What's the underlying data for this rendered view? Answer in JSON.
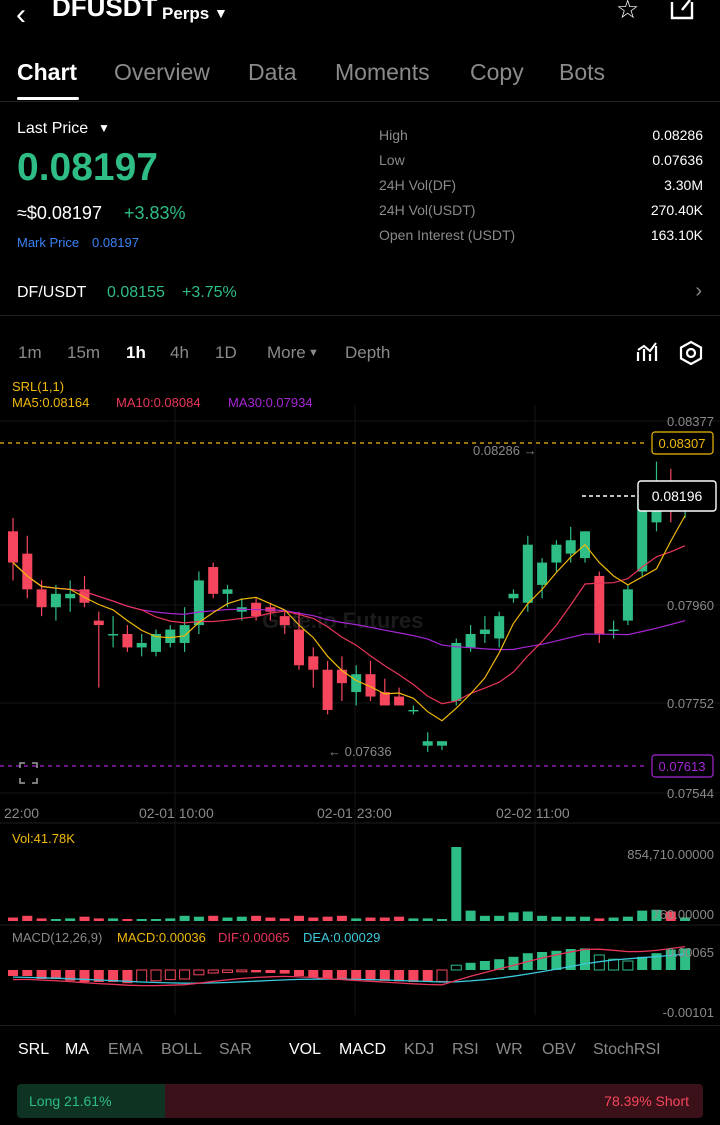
{
  "header": {
    "back_icon": "chevron-left-icon",
    "symbol": "DFUSDT",
    "market_type": "Perps",
    "favorite_icon": "star-icon",
    "share_icon": "share-icon"
  },
  "tabs": [
    {
      "label": "Chart",
      "active": true
    },
    {
      "label": "Overview",
      "active": false
    },
    {
      "label": "Data",
      "active": false
    },
    {
      "label": "Moments",
      "active": false
    },
    {
      "label": "Copy",
      "active": false
    },
    {
      "label": "Bots",
      "active": false
    }
  ],
  "price": {
    "label": "Last Price",
    "value": "0.08197",
    "approx": "≈$0.08197",
    "change": "+3.83%",
    "mark_label": "Mark Price",
    "mark_value": "0.08197"
  },
  "stats": [
    {
      "label": "High",
      "value": "0.08286"
    },
    {
      "label": "Low",
      "value": "0.07636"
    },
    {
      "label": "24H Vol(DF)",
      "value": "3.30M"
    },
    {
      "label": "24H Vol(USDT)",
      "value": "270.40K"
    },
    {
      "label": "Open Interest (USDT)",
      "value": "163.10K"
    }
  ],
  "spot_pair": {
    "name": "DF/USDT",
    "price": "0.08155",
    "change": "+3.75%"
  },
  "timeframes": [
    {
      "label": "1m",
      "active": false
    },
    {
      "label": "15m",
      "active": false
    },
    {
      "label": "1h",
      "active": true
    },
    {
      "label": "4h",
      "active": false
    },
    {
      "label": "1D",
      "active": false
    },
    {
      "label": "More",
      "active": false
    },
    {
      "label": "Depth",
      "active": false
    }
  ],
  "indicators": {
    "srl": "SRL(1,1)",
    "ma5": "MA5:0.08164",
    "ma10": "MA10:0.08084",
    "ma30": "MA30:0.07934",
    "vol": "Vol:41.78K",
    "macd_name": "MACD(12,26,9)",
    "macd": "MACD:0.00036",
    "dif": "DIF:0.00065",
    "dea": "DEA:0.00029"
  },
  "price_axis": {
    "ticks": [
      "0.08377",
      "0.07960",
      "0.07752",
      "0.07544"
    ],
    "srl_upper": "0.08307",
    "srl_lower": "0.07613",
    "current": "0.08196",
    "high_marker": "0.08286 →",
    "low_marker": "← 0.07636"
  },
  "time_axis": [
    "22:00",
    "02-01 10:00",
    "02-01 23:00",
    "02-02 11:00"
  ],
  "volume_axis": [
    "854,710.00000",
    "760.00000"
  ],
  "macd_axis": [
    "0.00065",
    "-0.00101"
  ],
  "watermark": "Gate.io Futures",
  "colors": {
    "up": "#2ebd85",
    "down": "#f6465d",
    "ma5": "#f0b90b",
    "ma10": "#e8365a",
    "ma30": "#a626d6",
    "srl": "#f0b90b",
    "accent_blue": "#3b82f6"
  },
  "chart_data": {
    "type": "candlestick",
    "interval": "1h",
    "candles": [
      {
        "o": 0.0813,
        "h": 0.0816,
        "l": 0.0802,
        "c": 0.0806
      },
      {
        "o": 0.0808,
        "h": 0.0812,
        "l": 0.0798,
        "c": 0.08
      },
      {
        "o": 0.08,
        "h": 0.0802,
        "l": 0.0794,
        "c": 0.0796
      },
      {
        "o": 0.0796,
        "h": 0.0801,
        "l": 0.0793,
        "c": 0.0799
      },
      {
        "o": 0.0798,
        "h": 0.0802,
        "l": 0.0795,
        "c": 0.0799
      },
      {
        "o": 0.08,
        "h": 0.0803,
        "l": 0.0796,
        "c": 0.0797
      },
      {
        "o": 0.0793,
        "h": 0.0795,
        "l": 0.0778,
        "c": 0.0792
      },
      {
        "o": 0.079,
        "h": 0.0794,
        "l": 0.0787,
        "c": 0.079
      },
      {
        "o": 0.079,
        "h": 0.0792,
        "l": 0.0786,
        "c": 0.0787
      },
      {
        "o": 0.0787,
        "h": 0.079,
        "l": 0.0785,
        "c": 0.0788
      },
      {
        "o": 0.0786,
        "h": 0.0791,
        "l": 0.0785,
        "c": 0.079
      },
      {
        "o": 0.0788,
        "h": 0.0792,
        "l": 0.0787,
        "c": 0.0791
      },
      {
        "o": 0.0788,
        "h": 0.0796,
        "l": 0.0786,
        "c": 0.0792
      },
      {
        "o": 0.0792,
        "h": 0.0804,
        "l": 0.079,
        "c": 0.0802
      },
      {
        "o": 0.0805,
        "h": 0.0806,
        "l": 0.0798,
        "c": 0.0799
      },
      {
        "o": 0.0799,
        "h": 0.0801,
        "l": 0.0796,
        "c": 0.08
      },
      {
        "o": 0.0795,
        "h": 0.0798,
        "l": 0.0793,
        "c": 0.0796
      },
      {
        "o": 0.0797,
        "h": 0.0798,
        "l": 0.0793,
        "c": 0.0794
      },
      {
        "o": 0.0796,
        "h": 0.0797,
        "l": 0.0793,
        "c": 0.0795
      },
      {
        "o": 0.0794,
        "h": 0.0795,
        "l": 0.079,
        "c": 0.0792
      },
      {
        "o": 0.0791,
        "h": 0.0795,
        "l": 0.0782,
        "c": 0.0783
      },
      {
        "o": 0.0785,
        "h": 0.0787,
        "l": 0.0778,
        "c": 0.0782
      },
      {
        "o": 0.0782,
        "h": 0.0784,
        "l": 0.0772,
        "c": 0.0773
      },
      {
        "o": 0.0782,
        "h": 0.0785,
        "l": 0.0775,
        "c": 0.0779
      },
      {
        "o": 0.0777,
        "h": 0.0783,
        "l": 0.0774,
        "c": 0.0781
      },
      {
        "o": 0.0781,
        "h": 0.0784,
        "l": 0.0775,
        "c": 0.0776
      },
      {
        "o": 0.0777,
        "h": 0.078,
        "l": 0.0774,
        "c": 0.0774
      },
      {
        "o": 0.0776,
        "h": 0.0778,
        "l": 0.0774,
        "c": 0.0774
      },
      {
        "o": 0.0773,
        "h": 0.0774,
        "l": 0.0772,
        "c": 0.0773
      },
      {
        "o": 0.0765,
        "h": 0.0768,
        "l": 0.07636,
        "c": 0.0766
      },
      {
        "o": 0.0765,
        "h": 0.0766,
        "l": 0.0764,
        "c": 0.0766
      },
      {
        "o": 0.0775,
        "h": 0.0789,
        "l": 0.0774,
        "c": 0.0788
      },
      {
        "o": 0.0787,
        "h": 0.0792,
        "l": 0.0786,
        "c": 0.079
      },
      {
        "o": 0.079,
        "h": 0.0794,
        "l": 0.0788,
        "c": 0.0791
      },
      {
        "o": 0.0789,
        "h": 0.0795,
        "l": 0.0787,
        "c": 0.0794
      },
      {
        "o": 0.0798,
        "h": 0.08,
        "l": 0.0797,
        "c": 0.0799
      },
      {
        "o": 0.0797,
        "h": 0.0812,
        "l": 0.0795,
        "c": 0.081
      },
      {
        "o": 0.0801,
        "h": 0.0807,
        "l": 0.0798,
        "c": 0.0806
      },
      {
        "o": 0.0806,
        "h": 0.0811,
        "l": 0.0804,
        "c": 0.081
      },
      {
        "o": 0.0808,
        "h": 0.0814,
        "l": 0.0806,
        "c": 0.0811
      },
      {
        "o": 0.0807,
        "h": 0.0813,
        "l": 0.0806,
        "c": 0.0813
      },
      {
        "o": 0.0803,
        "h": 0.0804,
        "l": 0.0788,
        "c": 0.079
      },
      {
        "o": 0.0791,
        "h": 0.0793,
        "l": 0.0789,
        "c": 0.0791
      },
      {
        "o": 0.0793,
        "h": 0.0801,
        "l": 0.0792,
        "c": 0.08
      },
      {
        "o": 0.0804,
        "h": 0.0823,
        "l": 0.0803,
        "c": 0.082
      },
      {
        "o": 0.0815,
        "h": 0.08286,
        "l": 0.0813,
        "c": 0.0822
      },
      {
        "o": 0.0822,
        "h": 0.0827,
        "l": 0.0815,
        "c": 0.0821
      },
      {
        "o": 0.0819,
        "h": 0.0821,
        "l": 0.0816,
        "c": 0.08197
      }
    ],
    "volume": [
      40000,
      60000,
      30000,
      20000,
      30000,
      50000,
      30000,
      30000,
      20000,
      20000,
      20000,
      30000,
      60000,
      50000,
      60000,
      40000,
      50000,
      60000,
      40000,
      30000,
      60000,
      40000,
      50000,
      60000,
      30000,
      40000,
      40000,
      50000,
      30000,
      30000,
      20000,
      854710,
      120000,
      60000,
      60000,
      100000,
      110000,
      60000,
      50000,
      50000,
      50000,
      30000,
      40000,
      50000,
      120000,
      130000,
      110000,
      41780
    ],
    "macd_hist": [
      -0.0001,
      -0.0001,
      -0.00015,
      -0.00015,
      -0.00018,
      -0.0002,
      -0.0002,
      -0.0002,
      -0.00022,
      -0.0002,
      -0.00018,
      -0.00016,
      -0.00015,
      -8e-05,
      -5e-05,
      -4e-05,
      -3e-05,
      -4e-05,
      -5e-05,
      -6e-05,
      -0.0001,
      -0.00012,
      -0.00015,
      -0.00016,
      -0.00016,
      -0.00017,
      -0.00018,
      -0.00019,
      -0.0002,
      -0.0002,
      -0.00019,
      8e-05,
      0.00012,
      0.00015,
      0.00018,
      0.00022,
      0.00028,
      0.0003,
      0.00032,
      0.00035,
      0.00036,
      0.00025,
      0.00018,
      0.00015,
      0.00022,
      0.00028,
      0.00034,
      0.00036
    ],
    "price_range": [
      0.07544,
      0.08377
    ]
  }
}
